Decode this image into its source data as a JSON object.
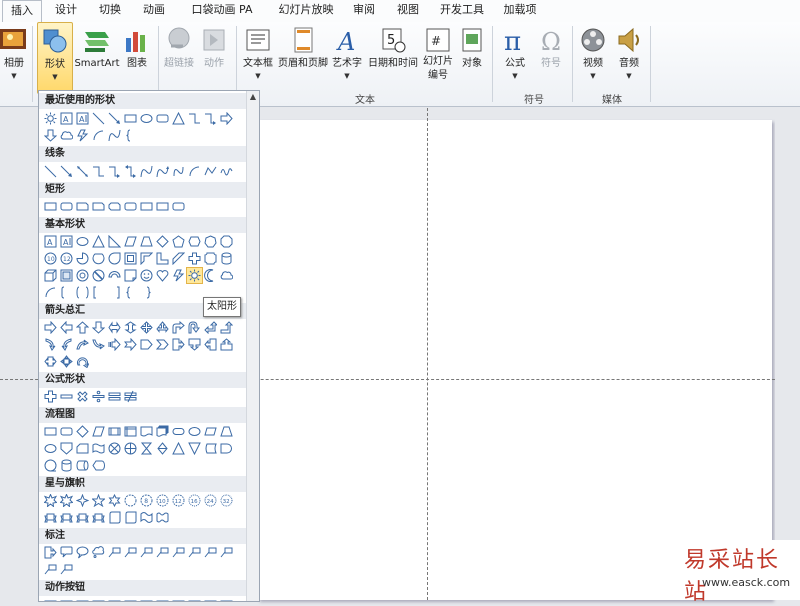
{
  "tabs": [
    "插入",
    "设计",
    "切换",
    "动画",
    "口袋动画 PA",
    "幻灯片放映",
    "审阅",
    "视图",
    "开发工具",
    "加载项"
  ],
  "ribbon": {
    "album": "相册",
    "shapes": "形状",
    "smartart": "SmartArt",
    "chart": "图表",
    "hyperlink": "超链接",
    "action": "动作",
    "textbox": "文本框",
    "header_footer": "页眉和页脚",
    "wordart": "艺术字",
    "datetime": "日期和时间",
    "slide_number_1": "幻灯片",
    "slide_number_2": "编号",
    "object": "对象",
    "equation": "公式",
    "symbol": "符号",
    "video": "视频",
    "audio": "音频",
    "group_text": "文本",
    "group_symbol": "符号",
    "group_media": "媒体"
  },
  "panel": {
    "categories": [
      "最近使用的形状",
      "线条",
      "矩形",
      "基本形状",
      "箭头总汇",
      "公式形状",
      "流程图",
      "星与旗帜",
      "标注",
      "动作按钮"
    ],
    "tooltip": "太阳形"
  },
  "watermark": {
    "title": "易采站长站",
    "url": "www.easck.com"
  }
}
